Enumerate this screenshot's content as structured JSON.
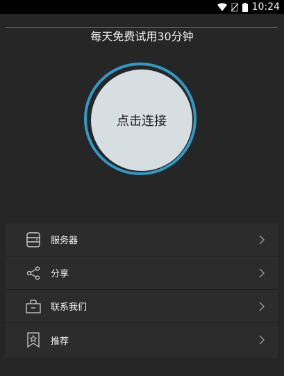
{
  "status_bar": {
    "time": "10:24",
    "icons": [
      "wifi-icon",
      "no-sim-icon",
      "battery-icon"
    ]
  },
  "header": {
    "title": "每天免费试用30分钟"
  },
  "connect": {
    "label": "点击连接",
    "ring_color": "#2f9bc8",
    "button_color": "#d6dee2"
  },
  "menu": {
    "items": [
      {
        "label": "服务器",
        "icon": "server-icon"
      },
      {
        "label": "分享",
        "icon": "share-icon"
      },
      {
        "label": "联系我们",
        "icon": "contact-icon"
      },
      {
        "label": "推荐",
        "icon": "recommend-icon"
      }
    ]
  }
}
